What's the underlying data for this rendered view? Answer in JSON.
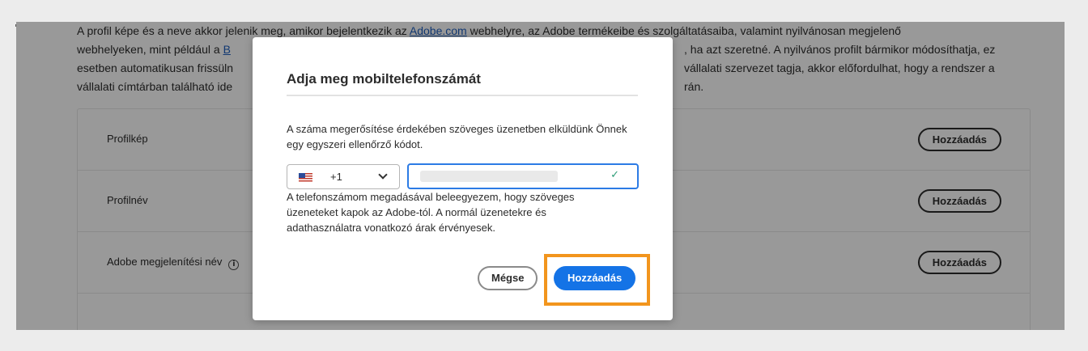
{
  "intro": {
    "p1": "A profil képe és a neve akkor jelenik meg, amikor bejelentkezik az ",
    "link1": "Adobe.com",
    "p2": " webhelyre, az Adobe termékeibe és szolgáltatásaiba, valamint nyilvánosan megjelenő",
    "line2a": "webhelyeken, mint például a ",
    "link2": "B",
    "line2b": "                                                                                   , ha azt szeretné. A nyilvános profilt bármikor módosíthatja, ez",
    "line3a": "esetben automatikusan frissüln",
    "line3b": "vállalati szervezet tagja, akkor előfordulhat, hogy a rendszer a",
    "line4a": "vállalati címtárban található ide",
    "line4b": "rán."
  },
  "rows": [
    {
      "label": "Profilkép",
      "button": "Hozzáadás"
    },
    {
      "label": "Profilnév",
      "button": "Hozzáadás"
    },
    {
      "label": "Adobe megjelenítési név",
      "button": "Hozzáadás",
      "info_icon": "info-icon"
    }
  ],
  "modal": {
    "title": "Adja meg mobiltelefonszámát",
    "description": "A száma megerősítése érdekében szöveges üzenetben elküldünk Önnek egy egyszeri ellenőrző kódot.",
    "country_code": "+1",
    "country_flag_icon": "us-flag-icon",
    "check_symbol": "✓",
    "consent": "A telefonszámom megadásával beleegyezem, hogy szöveges üzeneteket kapok az Adobe-tól. A normál üzenetekre és adathasználatra vonatkozó árak érvényesek.",
    "cancel_label": "Mégse",
    "add_label": "Hozzáadás"
  },
  "colors": {
    "primary": "#1473e6",
    "highlight": "#f2951d",
    "success": "#2d9d78",
    "link": "#1f5fbf"
  }
}
